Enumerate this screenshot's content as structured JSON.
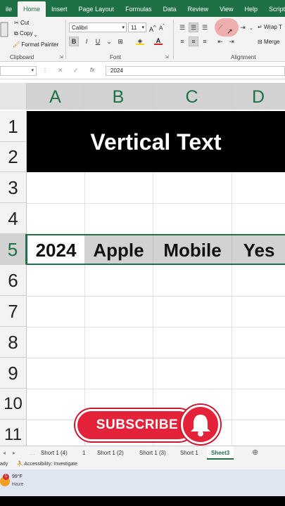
{
  "ribbon_tabs": [
    "ile",
    "Home",
    "Insert",
    "Page Layout",
    "Formulas",
    "Data",
    "Review",
    "View",
    "Help",
    "Script Lab"
  ],
  "active_tab": "Home",
  "clipboard": {
    "cut": "Cut",
    "copy": "Copy",
    "format_painter": "Format Painter",
    "label": "Clipboard"
  },
  "font": {
    "name": "Calibri",
    "size": "11",
    "label": "Font",
    "bold": "B",
    "italic": "I",
    "underline": "U"
  },
  "alignment": {
    "wrap": "Wrap T",
    "merge": "Merge",
    "label": "Alignment"
  },
  "formula_bar": {
    "fx": "fx",
    "value": "2024"
  },
  "columns": [
    "A",
    "B",
    "C",
    "D"
  ],
  "rows": [
    "1",
    "2",
    "3",
    "4",
    "5",
    "6",
    "7",
    "8",
    "9",
    "10",
    "11"
  ],
  "merged_title": "Vertical Text",
  "row5": [
    "2024",
    "Apple",
    "Mobile",
    "Yes"
  ],
  "sheet_tabs": [
    "Short 1 (4)",
    "1",
    "Short 1 (2)",
    "Short 1 (3)",
    "Short 1",
    "Sheet3"
  ],
  "active_sheet": "Sheet3",
  "status": {
    "ready": "ady",
    "accessibility": "Accessibility: Investigate"
  },
  "weather": {
    "temp": "99°F",
    "desc": "Haze",
    "badge": "1"
  },
  "overlay": {
    "subscribe": "SUBSCRIBE"
  },
  "colors": {
    "excel_green": "#1e7145",
    "subscribe_red": "#e4233a"
  }
}
